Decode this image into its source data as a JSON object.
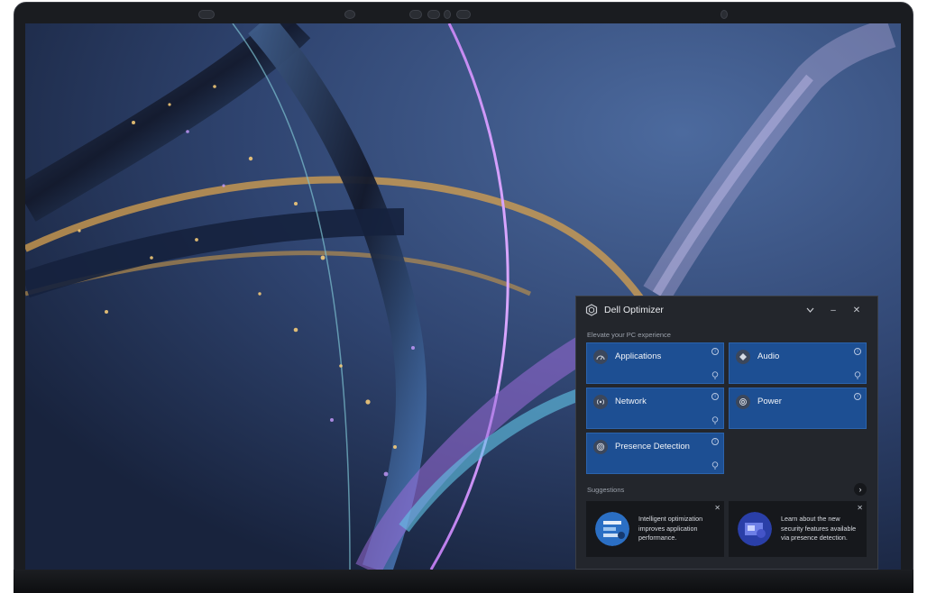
{
  "optimizer": {
    "title": "Dell Optimizer",
    "subtitle": "Elevate your PC experience",
    "controls": {
      "collapse": "⌵",
      "minimize": "–",
      "close": "✕"
    },
    "tiles": [
      {
        "label": "Applications",
        "icon": "speedometer-icon"
      },
      {
        "label": "Audio",
        "icon": "audio-icon"
      },
      {
        "label": "Network",
        "icon": "network-icon"
      },
      {
        "label": "Power",
        "icon": "power-icon"
      },
      {
        "label": "Presence Detection",
        "icon": "presence-icon"
      }
    ],
    "suggestions_label": "Suggestions",
    "suggestions_next": "›",
    "cards": [
      {
        "text": "Intelligent optimization improves application performance.",
        "close": "✕"
      },
      {
        "text": "Learn about the new security features available via presence detection.",
        "close": "✕"
      }
    ],
    "colors": {
      "tile": "#1d4f93",
      "panel": "#23262c",
      "card": "#16181c"
    }
  }
}
